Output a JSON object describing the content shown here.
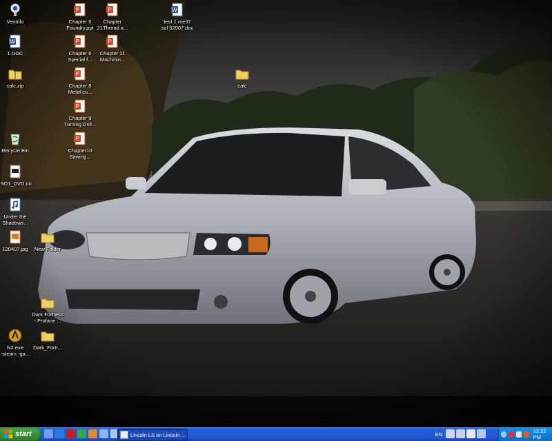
{
  "desktop": {
    "icons": [
      {
        "name": "ventrilo-icon",
        "label": "Ventrilo",
        "type": "app"
      },
      {
        "name": "doc-icon",
        "label": "1.DOC",
        "type": "word"
      },
      {
        "name": "zip-icon",
        "label": "calc.zip",
        "type": "zip"
      },
      {
        "name": "recycle-bin-icon",
        "label": "Recycle Bin",
        "type": "recycle"
      },
      {
        "name": "nri-icon",
        "label": "ISO1_DVD.nri",
        "type": "file"
      },
      {
        "name": "audio-icon",
        "label": "Under the\nShadows...",
        "type": "audio"
      },
      {
        "name": "image-icon",
        "label": "120407.jpg",
        "type": "image"
      },
      {
        "name": "folder-icon",
        "label": "New Folder",
        "type": "folder"
      },
      {
        "name": "folder-icon",
        "label": "Dark Fortress\n- Profane ...",
        "type": "folder"
      },
      {
        "name": "n2-exe-icon",
        "label": "N2.exe\n-steam -ga...",
        "type": "exe"
      },
      {
        "name": "folder-icon",
        "label": "Dark_Fortr...",
        "type": "folder"
      },
      {
        "name": "ppt-icon",
        "label": "Chapter 5\nFoundry.ppt",
        "type": "ppt"
      },
      {
        "name": "ppt-icon",
        "label": "Chapter 6\nSpecial f...",
        "type": "ppt"
      },
      {
        "name": "ppt-icon",
        "label": "Chapter 8\nMetal cu...",
        "type": "ppt"
      },
      {
        "name": "ppt-icon",
        "label": "Chapter 9\nTurning Drill...",
        "type": "ppt"
      },
      {
        "name": "ppt-icon",
        "label": "Chapter10\nSawing...",
        "type": "ppt"
      },
      {
        "name": "ppt-icon",
        "label": "Chapter\n21Thread a...",
        "type": "ppt"
      },
      {
        "name": "ppt-icon",
        "label": "Chapter 11\nMachinin...",
        "type": "ppt"
      },
      {
        "name": "word-icon",
        "label": "test 1 me37\nsol 52007.doc",
        "type": "word"
      },
      {
        "name": "folder-icon",
        "label": "calc",
        "type": "folder"
      }
    ]
  },
  "taskbar": {
    "start_label": "start",
    "task_label": "Lincoln LS on Lincoln ...",
    "language": "EN",
    "clock": "12:22 PM"
  },
  "colors": {
    "taskbar_blue": "#245edb",
    "start_green": "#3c8f3c",
    "tray_blue": "#0f7fd8"
  }
}
